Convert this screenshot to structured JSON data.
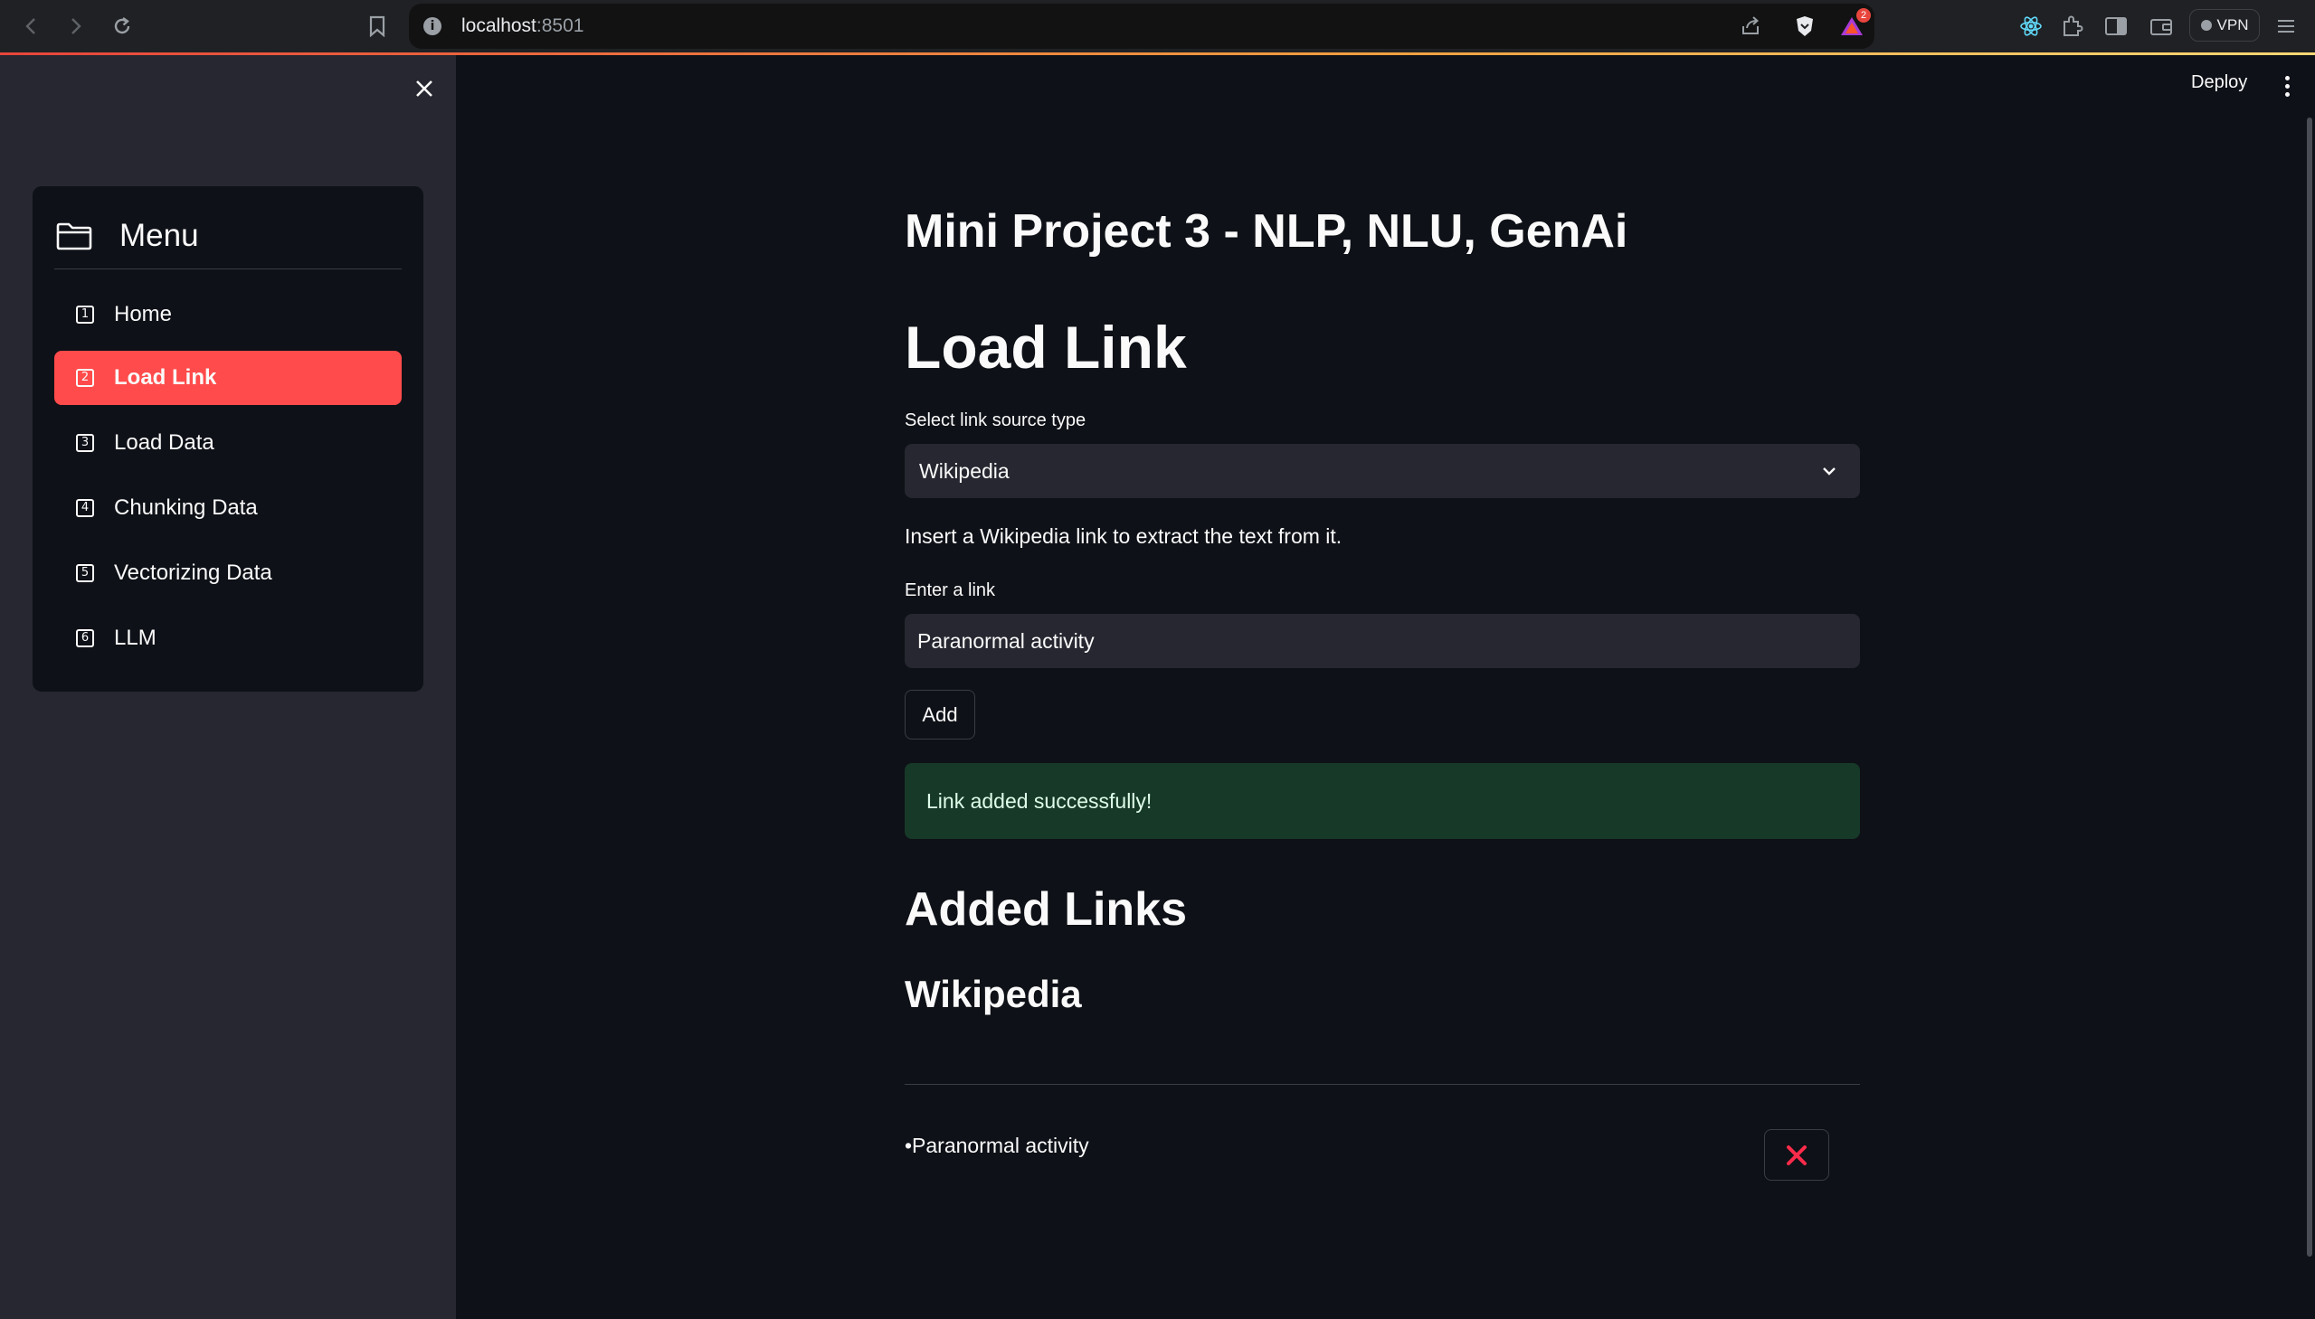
{
  "browser": {
    "url_host": "localhost",
    "url_port": ":8501",
    "notification_count": "2",
    "vpn_label": "VPN",
    "icons": [
      "back-icon",
      "forward-icon",
      "reload-icon",
      "bookmark-icon",
      "site-info-icon",
      "share-icon",
      "brave-shield-icon",
      "brave-rewards-icon",
      "react-devtools-icon",
      "extensions-icon",
      "sidebar-toggle-icon",
      "wallet-icon",
      "menu-icon"
    ]
  },
  "sidebar": {
    "menu_title": "Menu",
    "items": [
      {
        "num": "1",
        "label": "Home"
      },
      {
        "num": "2",
        "label": "Load Link",
        "active": true
      },
      {
        "num": "3",
        "label": "Load Data"
      },
      {
        "num": "4",
        "label": "Chunking Data"
      },
      {
        "num": "5",
        "label": "Vectorizing Data"
      },
      {
        "num": "6",
        "label": "LLM"
      }
    ]
  },
  "header": {
    "deploy_label": "Deploy"
  },
  "main": {
    "project_title": "Mini Project 3 - NLP, NLU, GenAi",
    "page_title": "Load Link",
    "select_label": "Select link source type",
    "select_value": "Wikipedia",
    "hint": "Insert a Wikipedia link to extract the text from it.",
    "input_label": "Enter a link",
    "input_value": "Paranormal activity",
    "add_label": "Add",
    "success_message": "Link added successfully!",
    "added_title": "Added Links",
    "source_title": "Wikipedia",
    "links": [
      "•Paranormal activity"
    ]
  },
  "colors": {
    "background": "#0e1117",
    "sidebar": "#262730",
    "accent": "#ff4b4b",
    "success_bg": "#173928",
    "success_text": "#dffde9",
    "remove_icon": "#ff2b4b"
  }
}
